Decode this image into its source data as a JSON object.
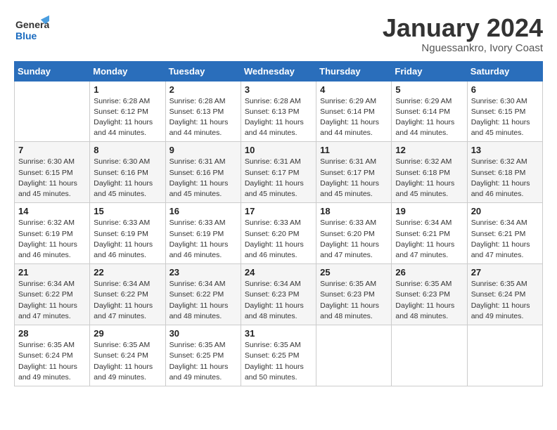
{
  "header": {
    "logo_general": "General",
    "logo_blue": "Blue",
    "month_title": "January 2024",
    "subtitle": "Nguessankro, Ivory Coast"
  },
  "days_of_week": [
    "Sunday",
    "Monday",
    "Tuesday",
    "Wednesday",
    "Thursday",
    "Friday",
    "Saturday"
  ],
  "weeks": [
    [
      null,
      {
        "day": "1",
        "sunrise": "Sunrise: 6:28 AM",
        "sunset": "Sunset: 6:12 PM",
        "daylight": "Daylight: 11 hours and 44 minutes."
      },
      {
        "day": "2",
        "sunrise": "Sunrise: 6:28 AM",
        "sunset": "Sunset: 6:13 PM",
        "daylight": "Daylight: 11 hours and 44 minutes."
      },
      {
        "day": "3",
        "sunrise": "Sunrise: 6:28 AM",
        "sunset": "Sunset: 6:13 PM",
        "daylight": "Daylight: 11 hours and 44 minutes."
      },
      {
        "day": "4",
        "sunrise": "Sunrise: 6:29 AM",
        "sunset": "Sunset: 6:14 PM",
        "daylight": "Daylight: 11 hours and 44 minutes."
      },
      {
        "day": "5",
        "sunrise": "Sunrise: 6:29 AM",
        "sunset": "Sunset: 6:14 PM",
        "daylight": "Daylight: 11 hours and 44 minutes."
      },
      {
        "day": "6",
        "sunrise": "Sunrise: 6:30 AM",
        "sunset": "Sunset: 6:15 PM",
        "daylight": "Daylight: 11 hours and 45 minutes."
      }
    ],
    [
      {
        "day": "7",
        "sunrise": "Sunrise: 6:30 AM",
        "sunset": "Sunset: 6:15 PM",
        "daylight": "Daylight: 11 hours and 45 minutes."
      },
      {
        "day": "8",
        "sunrise": "Sunrise: 6:30 AM",
        "sunset": "Sunset: 6:16 PM",
        "daylight": "Daylight: 11 hours and 45 minutes."
      },
      {
        "day": "9",
        "sunrise": "Sunrise: 6:31 AM",
        "sunset": "Sunset: 6:16 PM",
        "daylight": "Daylight: 11 hours and 45 minutes."
      },
      {
        "day": "10",
        "sunrise": "Sunrise: 6:31 AM",
        "sunset": "Sunset: 6:17 PM",
        "daylight": "Daylight: 11 hours and 45 minutes."
      },
      {
        "day": "11",
        "sunrise": "Sunrise: 6:31 AM",
        "sunset": "Sunset: 6:17 PM",
        "daylight": "Daylight: 11 hours and 45 minutes."
      },
      {
        "day": "12",
        "sunrise": "Sunrise: 6:32 AM",
        "sunset": "Sunset: 6:18 PM",
        "daylight": "Daylight: 11 hours and 45 minutes."
      },
      {
        "day": "13",
        "sunrise": "Sunrise: 6:32 AM",
        "sunset": "Sunset: 6:18 PM",
        "daylight": "Daylight: 11 hours and 46 minutes."
      }
    ],
    [
      {
        "day": "14",
        "sunrise": "Sunrise: 6:32 AM",
        "sunset": "Sunset: 6:19 PM",
        "daylight": "Daylight: 11 hours and 46 minutes."
      },
      {
        "day": "15",
        "sunrise": "Sunrise: 6:33 AM",
        "sunset": "Sunset: 6:19 PM",
        "daylight": "Daylight: 11 hours and 46 minutes."
      },
      {
        "day": "16",
        "sunrise": "Sunrise: 6:33 AM",
        "sunset": "Sunset: 6:19 PM",
        "daylight": "Daylight: 11 hours and 46 minutes."
      },
      {
        "day": "17",
        "sunrise": "Sunrise: 6:33 AM",
        "sunset": "Sunset: 6:20 PM",
        "daylight": "Daylight: 11 hours and 46 minutes."
      },
      {
        "day": "18",
        "sunrise": "Sunrise: 6:33 AM",
        "sunset": "Sunset: 6:20 PM",
        "daylight": "Daylight: 11 hours and 47 minutes."
      },
      {
        "day": "19",
        "sunrise": "Sunrise: 6:34 AM",
        "sunset": "Sunset: 6:21 PM",
        "daylight": "Daylight: 11 hours and 47 minutes."
      },
      {
        "day": "20",
        "sunrise": "Sunrise: 6:34 AM",
        "sunset": "Sunset: 6:21 PM",
        "daylight": "Daylight: 11 hours and 47 minutes."
      }
    ],
    [
      {
        "day": "21",
        "sunrise": "Sunrise: 6:34 AM",
        "sunset": "Sunset: 6:22 PM",
        "daylight": "Daylight: 11 hours and 47 minutes."
      },
      {
        "day": "22",
        "sunrise": "Sunrise: 6:34 AM",
        "sunset": "Sunset: 6:22 PM",
        "daylight": "Daylight: 11 hours and 47 minutes."
      },
      {
        "day": "23",
        "sunrise": "Sunrise: 6:34 AM",
        "sunset": "Sunset: 6:22 PM",
        "daylight": "Daylight: 11 hours and 48 minutes."
      },
      {
        "day": "24",
        "sunrise": "Sunrise: 6:34 AM",
        "sunset": "Sunset: 6:23 PM",
        "daylight": "Daylight: 11 hours and 48 minutes."
      },
      {
        "day": "25",
        "sunrise": "Sunrise: 6:35 AM",
        "sunset": "Sunset: 6:23 PM",
        "daylight": "Daylight: 11 hours and 48 minutes."
      },
      {
        "day": "26",
        "sunrise": "Sunrise: 6:35 AM",
        "sunset": "Sunset: 6:23 PM",
        "daylight": "Daylight: 11 hours and 48 minutes."
      },
      {
        "day": "27",
        "sunrise": "Sunrise: 6:35 AM",
        "sunset": "Sunset: 6:24 PM",
        "daylight": "Daylight: 11 hours and 49 minutes."
      }
    ],
    [
      {
        "day": "28",
        "sunrise": "Sunrise: 6:35 AM",
        "sunset": "Sunset: 6:24 PM",
        "daylight": "Daylight: 11 hours and 49 minutes."
      },
      {
        "day": "29",
        "sunrise": "Sunrise: 6:35 AM",
        "sunset": "Sunset: 6:24 PM",
        "daylight": "Daylight: 11 hours and 49 minutes."
      },
      {
        "day": "30",
        "sunrise": "Sunrise: 6:35 AM",
        "sunset": "Sunset: 6:25 PM",
        "daylight": "Daylight: 11 hours and 49 minutes."
      },
      {
        "day": "31",
        "sunrise": "Sunrise: 6:35 AM",
        "sunset": "Sunset: 6:25 PM",
        "daylight": "Daylight: 11 hours and 50 minutes."
      },
      null,
      null,
      null
    ]
  ]
}
